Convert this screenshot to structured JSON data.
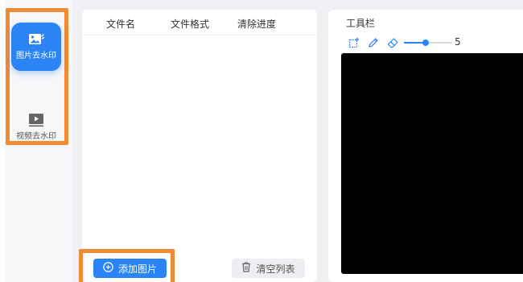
{
  "sidebar": {
    "items": [
      {
        "label": "图片去水印",
        "icon": "image-icon",
        "active": true
      },
      {
        "label": "视频去水印",
        "icon": "video-play-icon",
        "active": false
      }
    ]
  },
  "file_list": {
    "columns": [
      "文件名",
      "文件格式",
      "清除进度"
    ],
    "rows": []
  },
  "actions": {
    "add_label": "添加图片",
    "clear_label": "清空列表"
  },
  "toolbar": {
    "title": "工具栏",
    "tools": [
      "crop-icon",
      "pen-icon",
      "eraser-icon"
    ],
    "brush_size": 5,
    "brush_slider_level": 0.45
  },
  "colors": {
    "accent": "#2b84f5",
    "highlight": "#f08a35",
    "canvas": "#000000"
  }
}
